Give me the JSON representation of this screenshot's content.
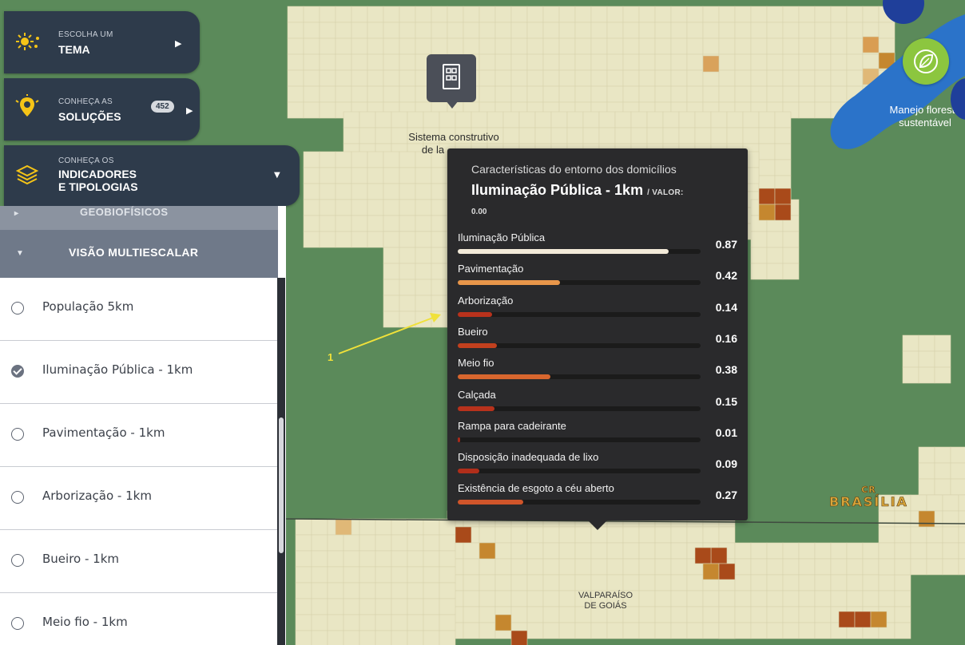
{
  "menu": {
    "tema": {
      "small": "ESCOLHA UM",
      "big": "TEMA",
      "icon": "sun-icon"
    },
    "solucoes": {
      "small": "CONHEÇA AS",
      "big": "SOLUÇÕES",
      "badge": "452",
      "icon": "lightbulb-pin-icon"
    },
    "indicadores": {
      "small": "CONHEÇA OS",
      "big_line1": "INDICADORES",
      "big_line2": "E TIPOLOGIAS",
      "icon": "layers-icon"
    }
  },
  "sidebar": {
    "geo_row": "GEOBIOFÍSICOS",
    "section": "VISÃO MULTIESCALAR",
    "items": [
      {
        "label": "População 5km",
        "checked": false
      },
      {
        "label": "Iluminação Pública - 1km",
        "checked": true
      },
      {
        "label": "Pavimentação - 1km",
        "checked": false
      },
      {
        "label": "Arborização - 1km",
        "checked": false
      },
      {
        "label": "Bueiro - 1km",
        "checked": false
      },
      {
        "label": "Meio fio - 1km",
        "checked": false
      }
    ]
  },
  "map": {
    "marker_label_line1": "Sistema construtivo",
    "marker_label_line2": "de la",
    "manejo_line1": "Manejo floresta",
    "manejo_line2": "sustentável",
    "brasilia_prefix": "CR",
    "brasilia": "BRASÍLIA",
    "valparaiso_line1": "VALPARAÍSO",
    "valparaiso_line2": "DE GOIÁS",
    "annotation_number": "1",
    "colors": {
      "land": "#5b8a5a",
      "cell": "#e9e6c4",
      "water": "#2b73c9"
    }
  },
  "tooltip": {
    "subtitle": "Características do entorno dos domicílios",
    "title": "Iluminação Pública - 1km",
    "value_caption": "/ VALOR:",
    "value": "0.00",
    "rows": [
      {
        "name": "Iluminação Pública",
        "value": "0.87",
        "color": "#f3ead9"
      },
      {
        "name": "Pavimentação",
        "value": "0.42",
        "color": "#e8964a"
      },
      {
        "name": "Arborização",
        "value": "0.14",
        "color": "#b8321c"
      },
      {
        "name": "Bueiro",
        "value": "0.16",
        "color": "#c2401e"
      },
      {
        "name": "Meio fio",
        "value": "0.38",
        "color": "#d8662e"
      },
      {
        "name": "Calçada",
        "value": "0.15",
        "color": "#b8321c"
      },
      {
        "name": "Rampa para cadeirante",
        "value": "0.01",
        "color": "#a82a1a"
      },
      {
        "name": "Disposição inadequada de lixo",
        "value": "0.09",
        "color": "#b02e1a"
      },
      {
        "name": "Existência de esgoto a céu aberto",
        "value": "0.27",
        "color": "#d0552a"
      }
    ]
  }
}
